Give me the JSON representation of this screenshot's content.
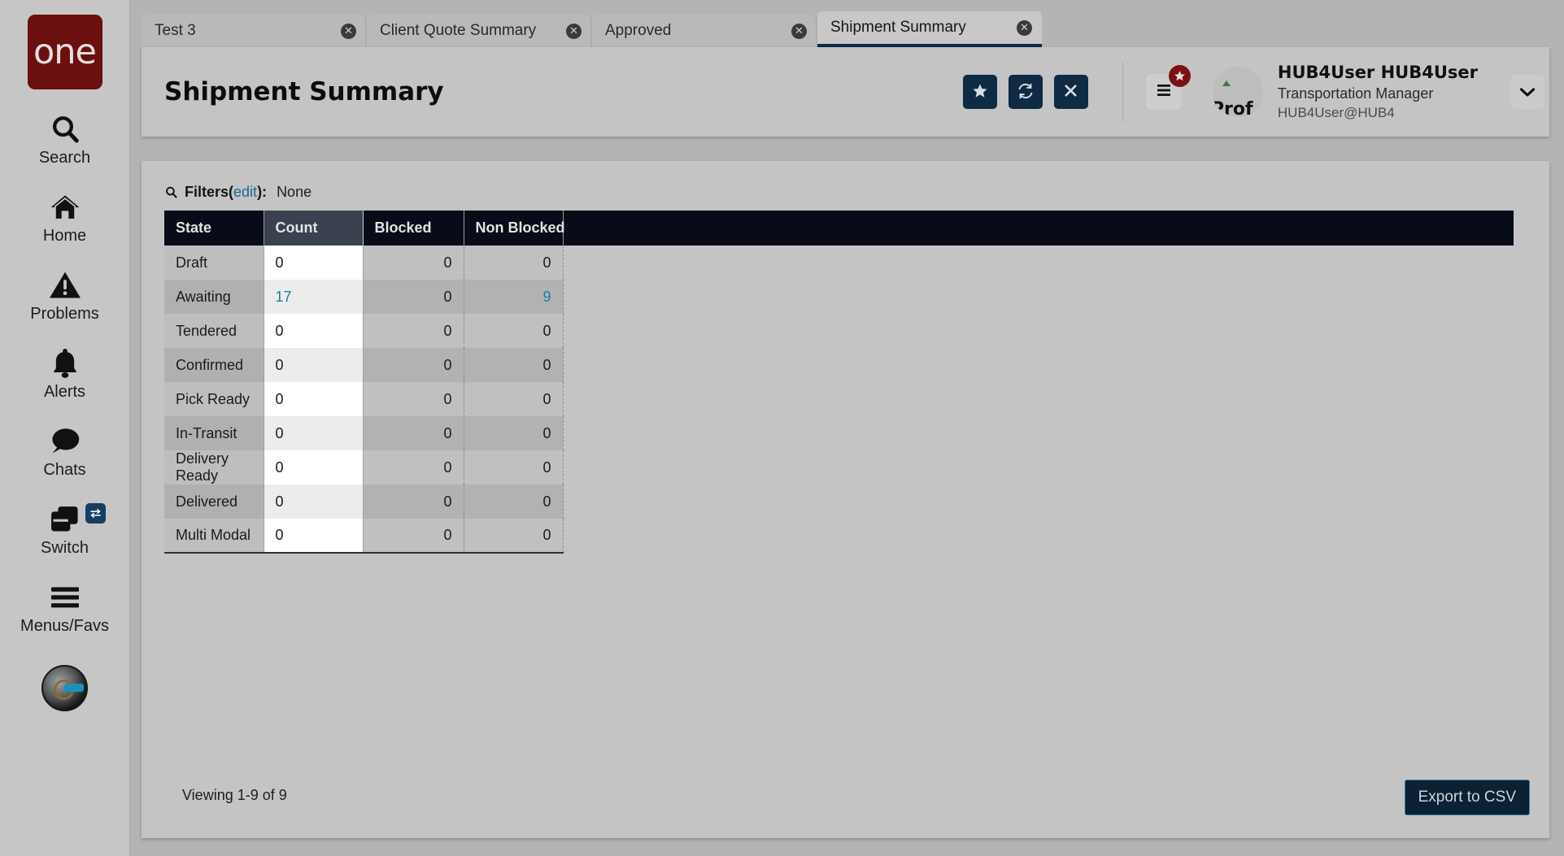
{
  "sidebar": {
    "logo_text": "one",
    "items": [
      {
        "label": "Search",
        "icon": "search-icon"
      },
      {
        "label": "Home",
        "icon": "home-icon"
      },
      {
        "label": "Problems",
        "icon": "warning-triangle-icon"
      },
      {
        "label": "Alerts",
        "icon": "bell-icon"
      },
      {
        "label": "Chats",
        "icon": "chat-bubble-icon"
      },
      {
        "label": "Switch",
        "icon": "copy-windows-icon",
        "badge_icon": "swap-arrows-icon"
      },
      {
        "label": "Menus/Favs",
        "icon": "hamburger-icon"
      }
    ],
    "bottom_avatar_icon": "robot-avatar-icon"
  },
  "tabs": [
    {
      "label": "Test 3",
      "active": false,
      "close_icon": "close-circle-icon"
    },
    {
      "label": "Client Quote Summary",
      "active": false,
      "close_icon": "close-circle-icon"
    },
    {
      "label": "Approved",
      "active": false,
      "close_icon": "close-circle-icon"
    },
    {
      "label": "Shipment Summary",
      "active": true,
      "close_icon": "close-circle-icon"
    }
  ],
  "header": {
    "title": "Shipment Summary",
    "actions": [
      {
        "name": "favorite-button",
        "icon": "star-icon"
      },
      {
        "name": "refresh-button",
        "icon": "refresh-icon"
      },
      {
        "name": "close-button",
        "icon": "x-icon"
      }
    ],
    "menu_button_icon": "hamburger-menu-icon",
    "menu_badge_icon": "star-icon",
    "user": {
      "avatar_alt": "Prof",
      "name": "HUB4User HUB4User",
      "role": "Transportation Manager",
      "email": "HUB4User@HUB4",
      "chevron_icon": "chevron-down-icon"
    }
  },
  "filters": {
    "icon": "search-icon",
    "label": "Filters",
    "edit_label": "edit",
    "colon": "):",
    "open_paren": "(",
    "value": "None"
  },
  "table": {
    "columns": [
      "State",
      "Count",
      "Blocked",
      "Non Blocked"
    ],
    "rows": [
      {
        "state": "Draft",
        "count": "0",
        "blocked": "0",
        "non_blocked": "0",
        "count_link": false,
        "non_blocked_link": false
      },
      {
        "state": "Awaiting",
        "count": "17",
        "blocked": "0",
        "non_blocked": "9",
        "count_link": true,
        "non_blocked_link": true
      },
      {
        "state": "Tendered",
        "count": "0",
        "blocked": "0",
        "non_blocked": "0",
        "count_link": false,
        "non_blocked_link": false
      },
      {
        "state": "Confirmed",
        "count": "0",
        "blocked": "0",
        "non_blocked": "0",
        "count_link": false,
        "non_blocked_link": false
      },
      {
        "state": "Pick Ready",
        "count": "0",
        "blocked": "0",
        "non_blocked": "0",
        "count_link": false,
        "non_blocked_link": false
      },
      {
        "state": "In-Transit",
        "count": "0",
        "blocked": "0",
        "non_blocked": "0",
        "count_link": false,
        "non_blocked_link": false
      },
      {
        "state": "Delivery Ready",
        "count": "0",
        "blocked": "0",
        "non_blocked": "0",
        "count_link": false,
        "non_blocked_link": false
      },
      {
        "state": "Delivered",
        "count": "0",
        "blocked": "0",
        "non_blocked": "0",
        "count_link": false,
        "non_blocked_link": false
      },
      {
        "state": "Multi Modal",
        "count": "0",
        "blocked": "0",
        "non_blocked": "0",
        "count_link": false,
        "non_blocked_link": false
      }
    ]
  },
  "footer": {
    "viewing": "Viewing 1-9 of 9",
    "export_label": "Export to CSV"
  },
  "colors": {
    "brand_red": "#6b0f0f",
    "navy": "#0e2a44",
    "table_header": "#070c18",
    "link_teal": "#1d7f9e",
    "badge_red": "#7b1114"
  }
}
